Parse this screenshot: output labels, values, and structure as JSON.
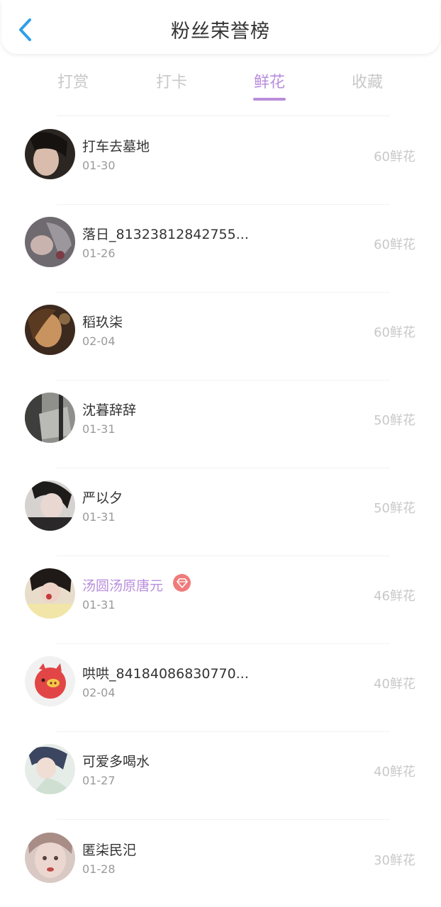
{
  "header": {
    "title": "粉丝荣誉榜"
  },
  "tabs": [
    {
      "label": "打赏"
    },
    {
      "label": "打卡"
    },
    {
      "label": "鲜花"
    },
    {
      "label": "收藏"
    }
  ],
  "list": [
    {
      "name": "打车去墓地",
      "date": "01-30",
      "amount": "60鲜花"
    },
    {
      "name": "落日_81323812842755...",
      "date": "01-26",
      "amount": "60鲜花"
    },
    {
      "name": "稻玖柒",
      "date": "02-04",
      "amount": "60鲜花"
    },
    {
      "name": "沈暮辞辞",
      "date": "01-31",
      "amount": "50鲜花"
    },
    {
      "name": "严以夕",
      "date": "01-31",
      "amount": "50鲜花"
    },
    {
      "name": "汤圆汤原唐元",
      "date": "01-31",
      "amount": "46鲜花"
    },
    {
      "name": "哄哄_84184086830770...",
      "date": "02-04",
      "amount": "40鲜花"
    },
    {
      "name": "可爱多喝水",
      "date": "01-27",
      "amount": "40鲜花"
    },
    {
      "name": "匿柒民汜",
      "date": "01-28",
      "amount": "30鲜花"
    }
  ],
  "colors": {
    "accent": "#b98ddb",
    "back": "#2ea0e8",
    "badge": "#f07b7b"
  }
}
